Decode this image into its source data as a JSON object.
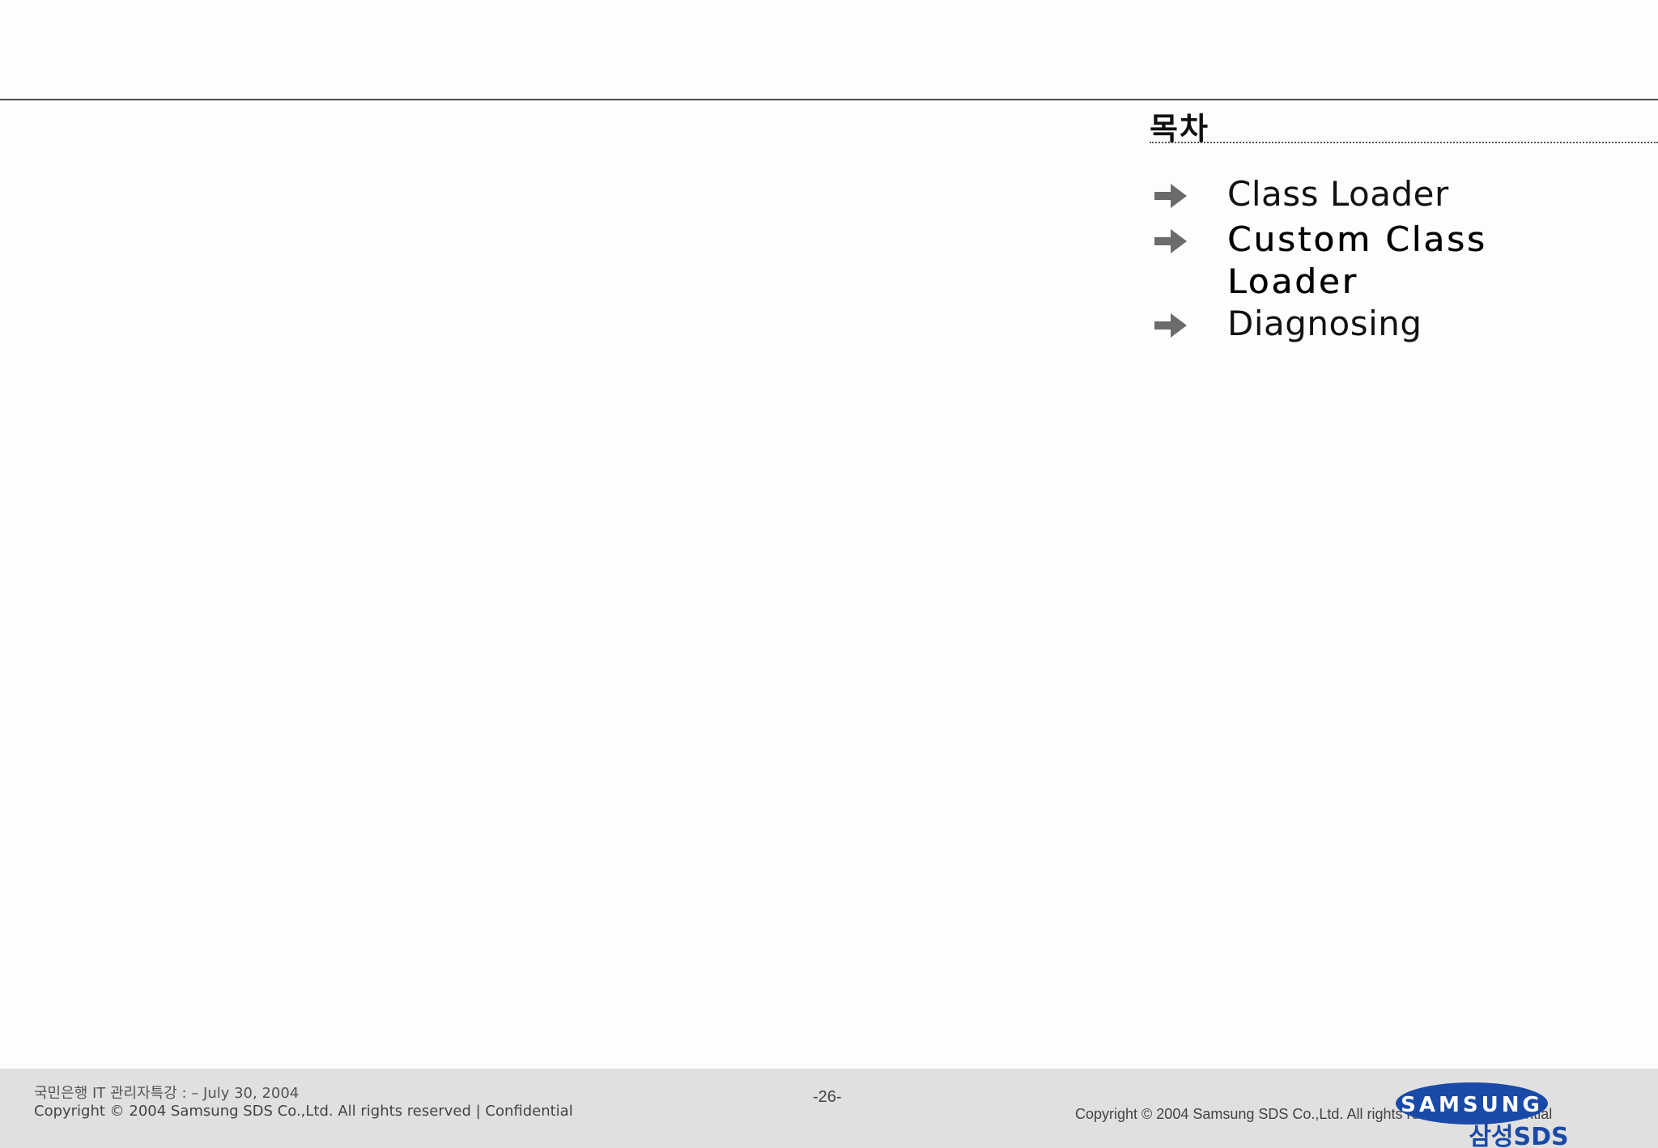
{
  "toc": {
    "title": "목차",
    "items": [
      {
        "label": "Class Loader",
        "active": false
      },
      {
        "label": "Custom Class Loader",
        "active": true
      },
      {
        "label": "Diagnosing",
        "active": false
      }
    ]
  },
  "footer": {
    "course_line": "국민은행 IT 관리자특강 : – July 30, 2004",
    "copyright_left": "Copyright © 2004 Samsung SDS Co.,Ltd. All rights reserved  |   Confidential",
    "page_number": "-26-",
    "copyright_right": "Copyright © 2004 Samsung SDS Co.,Ltd. All rights reserved  |   Confidential"
  },
  "logo": {
    "brand": "SAMSUNG",
    "sub_brand": "삼성SDS",
    "color": "#1a4aa8"
  },
  "colors": {
    "rule": "#4a4a4a",
    "arrow": "#6b6b6b",
    "footer_bg": "#e0e0e0"
  }
}
